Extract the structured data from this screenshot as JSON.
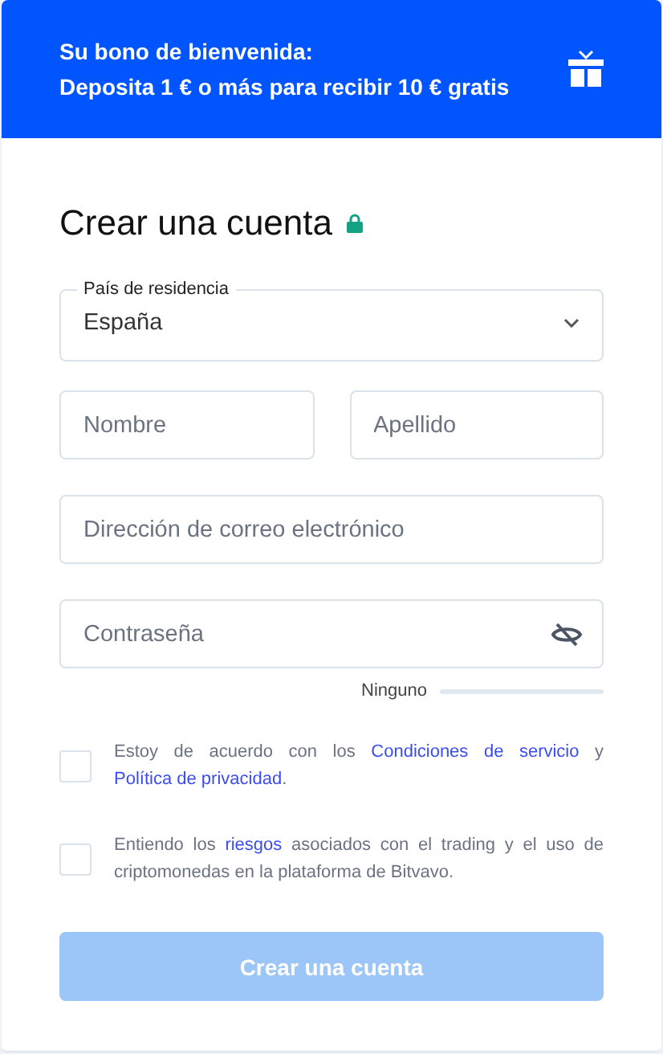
{
  "banner": {
    "title": "Su bono de bienvenida:",
    "subtitle": "Deposita 1 € o más para recibir 10 € gratis"
  },
  "heading": "Crear una cuenta",
  "country": {
    "label": "País de residencia",
    "value": "España"
  },
  "fields": [
    {
      "placeholder": "Nombre"
    },
    {
      "placeholder": "Apellido"
    }
  ],
  "email": {
    "placeholder": "Dirección de correo electrónico"
  },
  "password": {
    "placeholder": "Contraseña"
  },
  "strength": {
    "label": "Ninguno",
    "level": 0
  },
  "consents": [
    {
      "checked": false,
      "parts": [
        {
          "kind": "text",
          "text": "Estoy de acuerdo con los "
        },
        {
          "kind": "link",
          "text": "Condiciones de servicio"
        },
        {
          "kind": "text",
          "text": " y "
        },
        {
          "kind": "link",
          "text": "Política de privacidad"
        },
        {
          "kind": "text",
          "text": "."
        }
      ]
    },
    {
      "checked": false,
      "parts": [
        {
          "kind": "text",
          "text": "Entiendo los "
        },
        {
          "kind": "link",
          "text": "riesgos"
        },
        {
          "kind": "text",
          "text": " asociados con el trading y el uso de criptomonedas en la plataforma de Bitvavo."
        }
      ]
    }
  ],
  "submit": {
    "label": "Crear una cuenta",
    "disabled": true
  }
}
